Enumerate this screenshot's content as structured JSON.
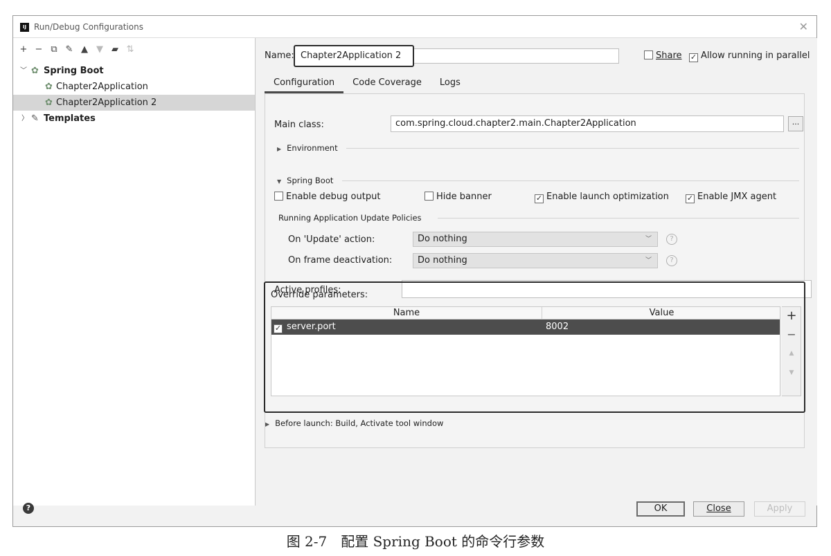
{
  "window": {
    "title": "Run/Debug Configurations",
    "app_icon_text": "IJ"
  },
  "toolbar": {
    "icons": [
      "plus-icon",
      "minus-icon",
      "copy-icon",
      "wrench-icon",
      "move-up-icon",
      "move-down-icon",
      "folder-icon",
      "sort-icon"
    ]
  },
  "tree": {
    "spring_boot": "Spring Boot",
    "children": [
      "Chapter2Application",
      "Chapter2Application 2"
    ],
    "selected_index": 1,
    "templates": "Templates"
  },
  "name": {
    "label": "Name:",
    "value": "Chapter2Application 2"
  },
  "share": {
    "label": "Share",
    "checked": false
  },
  "allow_parallel": {
    "label": "Allow running in parallel",
    "checked": true
  },
  "tabs": [
    "Configuration",
    "Code Coverage",
    "Logs"
  ],
  "active_tab": 0,
  "main_class": {
    "label": "Main class:",
    "value": "com.spring.cloud.chapter2.main.Chapter2Application"
  },
  "environment": {
    "label": "Environment"
  },
  "spring_boot_section": {
    "label": "Spring Boot",
    "options": [
      {
        "label": "Enable debug output",
        "checked": false
      },
      {
        "label": "Hide banner",
        "checked": false
      },
      {
        "label": "Enable launch optimization",
        "checked": true
      },
      {
        "label": "Enable JMX agent",
        "checked": true
      }
    ]
  },
  "policies": {
    "label": "Running Application Update Policies",
    "on_update": {
      "label": "On 'Update' action:",
      "value": "Do nothing"
    },
    "on_frame": {
      "label": "On frame deactivation:",
      "value": "Do nothing"
    }
  },
  "active_profiles": {
    "label": "Active profiles:",
    "value": ""
  },
  "override": {
    "label": "Override parameters:",
    "columns": [
      "Name",
      "Value"
    ],
    "rows": [
      {
        "checked": true,
        "name": "server.port",
        "value": "8002"
      }
    ]
  },
  "before_launch": {
    "label": "Before launch: Build, Activate tool window"
  },
  "buttons": {
    "ok": "OK",
    "close": "Close",
    "apply": "Apply"
  },
  "caption": "图 2-7　配置 Spring Boot 的命令行参数"
}
